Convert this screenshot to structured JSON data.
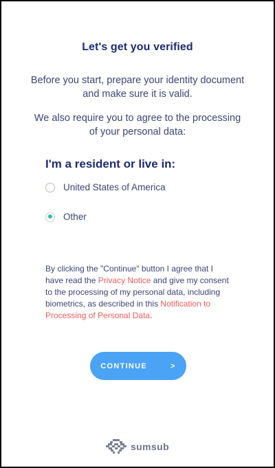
{
  "header": {
    "title": "Let's get you verified"
  },
  "intro": {
    "paragraph1": "Before you start, prepare your identity document and make sure it is valid.",
    "paragraph2": "We also require you to agree to the processing of your personal data:"
  },
  "residence": {
    "title": "I'm a resident or live in:",
    "options": [
      {
        "label": "United States of America",
        "selected": false
      },
      {
        "label": "Other",
        "selected": true
      }
    ]
  },
  "consent": {
    "text1": "By clicking the \"Continue\" button I agree that I have read the ",
    "privacy_link": "Privacy Notice",
    "text2": " and give my consent to the processing of my personal data, including biometrics, as described in this ",
    "notification_link": "Notification to Processing of Personal Data",
    "text3": "."
  },
  "actions": {
    "continue_label": "CONTINUE",
    "continue_arrow": ">"
  },
  "footer": {
    "brand": "sumsub",
    "logo_icon": "sumsub-logo-icon"
  },
  "colors": {
    "title": "#1d2a72",
    "text": "#3d4575",
    "link": "#ef5b5b",
    "button": "#4aa3f5",
    "radio_selected": "#22c4a4"
  }
}
